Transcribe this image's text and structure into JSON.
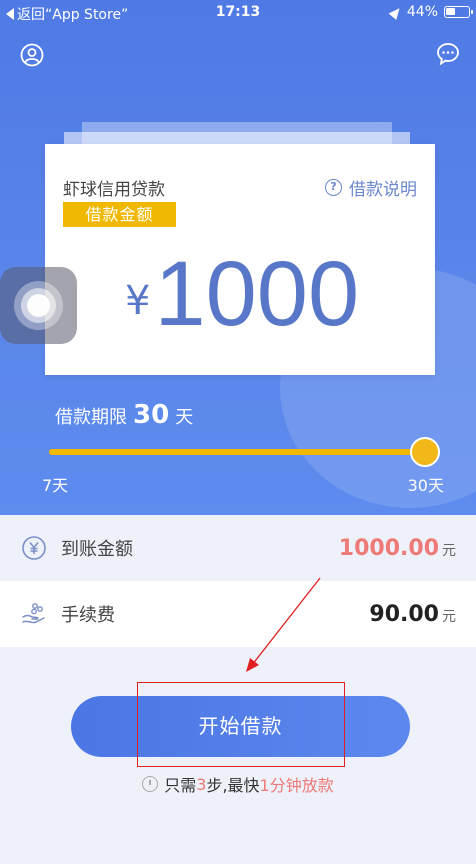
{
  "status_bar": {
    "back_label": "返回“App Store”",
    "time": "17:13",
    "battery": "44%",
    "battery_level": 0.44
  },
  "nav": {
    "left_icon": "user-circle-icon",
    "right_icon": "chat-bubble-icon"
  },
  "card": {
    "title": "虾球信用贷款",
    "badge": "借款金额",
    "help_label": "借款说明",
    "currency": "¥",
    "amount": "1000"
  },
  "term": {
    "label": "借款期限",
    "value": "30",
    "unit": "天",
    "min_label": "7天",
    "max_label": "30天",
    "slider_fraction": 1.0
  },
  "rows": [
    {
      "icon": "yen-circle-icon",
      "label": "到账金额",
      "value": "1000.00",
      "unit": "元"
    },
    {
      "icon": "hand-coins-icon",
      "label": "手续费",
      "value": "90.00",
      "unit": "元"
    }
  ],
  "cta": {
    "label": "开始借款"
  },
  "hint": {
    "p1": "只需",
    "steps": "3",
    "p2": "步,最快",
    "p3": "1分钟放款"
  },
  "colors": {
    "primary": "#5a86ea",
    "accent_yellow": "#f0b800",
    "highlight_red": "#ee7a78",
    "annotation": "#e02020"
  }
}
